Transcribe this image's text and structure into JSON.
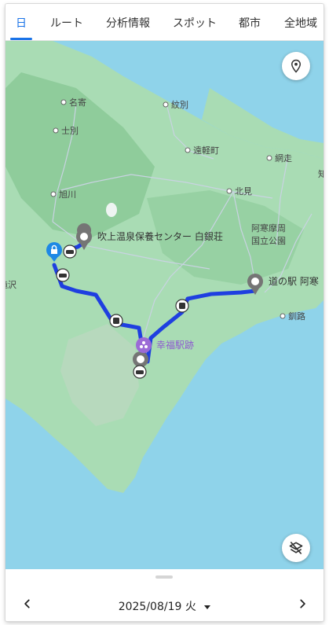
{
  "tabs": [
    {
      "label": "日"
    },
    {
      "label": "ルート"
    },
    {
      "label": "分析情報"
    },
    {
      "label": "スポット"
    },
    {
      "label": "都市"
    },
    {
      "label": "全地域"
    }
  ],
  "map": {
    "towns": {
      "nayoro": "名寄",
      "monbetsu": "紋別",
      "shibetsu": "士別",
      "engaru": "遠軽町",
      "abashiri": "網走",
      "asahikawa": "旭川",
      "kitami": "北見",
      "kushiro": "釧路",
      "park": "阿寒摩周",
      "park2": "国立公園",
      "edge_left": "滝沢",
      "edge_right": "知"
    },
    "places": {
      "onsen": "吹上温泉保養センター 白銀荘",
      "michinoeki": "道の駅 阿寒",
      "kofuku": "幸福駅跡"
    },
    "colors": {
      "route": "#1f3fe0",
      "pin": "#757575",
      "purple_pin": "#9b6bd6",
      "lock_pin": "#1e88e5"
    }
  },
  "footer": {
    "date": "2025/08/19 火"
  }
}
